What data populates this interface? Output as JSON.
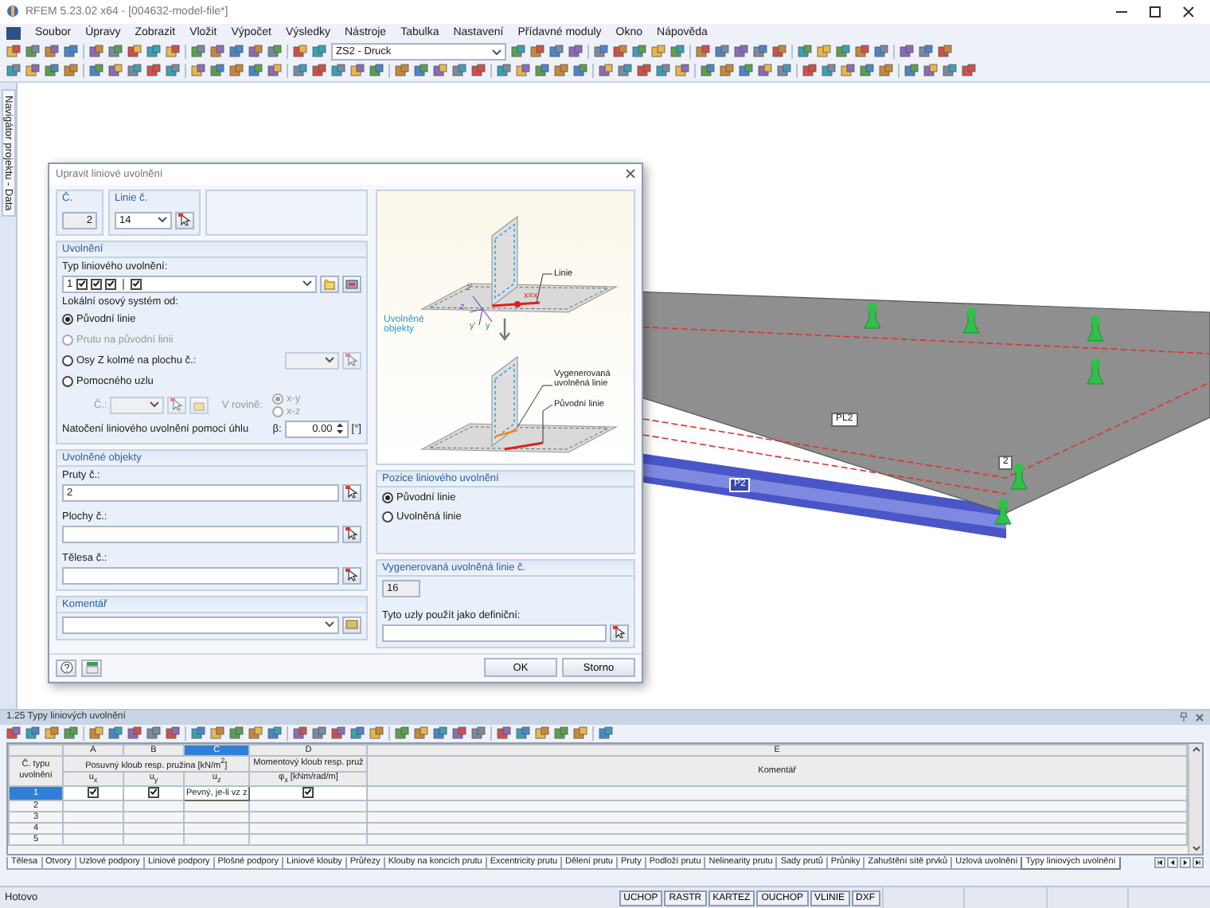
{
  "window": {
    "title": "RFEM 5.23.02 x64 - [004632-model-file*]"
  },
  "menu": [
    "Soubor",
    "Úpravy",
    "Zobrazit",
    "Vložit",
    "Výpočet",
    "Výsledky",
    "Nástroje",
    "Tabulka",
    "Nastavení",
    "Přídavné moduly",
    "Okno",
    "Nápověda"
  ],
  "toolbar": {
    "load_case": "ZS2 - Druck"
  },
  "navigator": {
    "label": "Navigátor projektu - Data"
  },
  "model_view": {
    "labels": [
      {
        "kind": "surface",
        "text": "PL2"
      },
      {
        "kind": "member",
        "text": "P2"
      },
      {
        "kind": "node",
        "text": "2"
      }
    ]
  },
  "dialog": {
    "title": "Upravit liniové uvolnění",
    "number": {
      "label": "Č.",
      "value": "2"
    },
    "line": {
      "label": "Linie č.",
      "value": "14"
    },
    "release": {
      "heading": "Uvolnění",
      "type_label": "Typ liniového uvolnění:",
      "type_number": "1",
      "type_checks": [
        {
          "checked": true
        },
        {
          "checked": true
        },
        {
          "checked": true
        },
        {
          "checked": true
        }
      ],
      "axis_label": "Lokální osový systém od:",
      "axis_options": [
        {
          "label": "Původní linie",
          "selected": true,
          "disabled": false
        },
        {
          "label": "Prutu na původní linii",
          "selected": false,
          "disabled": true
        },
        {
          "label": "Osy Z kolmé na plochu č.:",
          "selected": false,
          "disabled": false
        },
        {
          "label": "Pomocného uzlu",
          "selected": false,
          "disabled": false
        }
      ],
      "node_label": "Č.:",
      "plane_label": "V rovině:",
      "plane_options": [
        {
          "label": "x-y",
          "selected": true,
          "disabled": true
        },
        {
          "label": "x-z",
          "selected": false,
          "disabled": true
        }
      ],
      "rotation_label": "Natočení liniového uvolnění pomocí úhlu",
      "beta_label": "β:",
      "beta_value": "0.00",
      "beta_unit": "[°]"
    },
    "objects": {
      "heading": "Uvolněné objekty",
      "fields": [
        {
          "label": "Pruty č.:",
          "value": "2"
        },
        {
          "label": "Plochy č.:"
        },
        {
          "label": "Tělesa č.:"
        }
      ]
    },
    "comment": {
      "heading": "Komentář"
    },
    "diagram": {
      "labels": [
        {
          "kind": "line",
          "text": "Linie"
        },
        {
          "kind": "objects",
          "text": "Uvolněné objekty"
        },
        {
          "kind": "generated",
          "text": "Vygenerovaná uvolněná linie"
        },
        {
          "kind": "original",
          "text": "Původní linie"
        },
        {
          "kind": "axis_x",
          "text": "x=x'"
        },
        {
          "kind": "axis_z1",
          "text": "z'"
        },
        {
          "kind": "axis_z",
          "text": "z"
        },
        {
          "kind": "axis_y1",
          "text": "y'"
        },
        {
          "kind": "axis_y",
          "text": "y"
        }
      ]
    },
    "position": {
      "heading": "Pozice liniového uvolnění",
      "options": [
        {
          "label": "Původní linie",
          "selected": true
        },
        {
          "label": "Uvolněná linie",
          "selected": false
        }
      ]
    },
    "generated": {
      "heading": "Vygenerovaná uvolněná linie č.",
      "value": "16",
      "nodes_label": "Tyto uzly použít jako definiční:"
    },
    "buttons": [
      "OK",
      "Storno"
    ]
  },
  "table_panel": {
    "title": "1.25 Typy liniových uvolnění",
    "row_header": "Č. typu uvolnění",
    "columns": [
      {
        "letter": "A",
        "selected": false
      },
      {
        "letter": "B",
        "selected": false
      },
      {
        "letter": "C",
        "selected": true
      },
      {
        "letter": "D",
        "selected": false
      },
      {
        "letter": "E",
        "selected": false
      }
    ],
    "header_groups": [
      {
        "text": "Posuvný kloub resp. pružina [kN/m$^{2}$]",
        "subheaders": [
          "u$_{x}$",
          "u$_{y}$",
          "u$_{z}$"
        ]
      },
      {
        "text": "Momentový kloub resp. pruž",
        "subheaders": [
          "φ$_{x}$ [kNm/rad/m]"
        ]
      },
      {
        "text": "Komentář"
      }
    ],
    "rows": [
      {
        "number": "1",
        "selected": true,
        "cells": [
          {
            "kind": "checkbox",
            "checked": true
          },
          {
            "kind": "checkbox",
            "checked": true
          },
          {
            "kind": "text",
            "text": "Pevný, je-li vz z"
          },
          {
            "kind": "checkbox",
            "checked": true
          }
        ]
      },
      {
        "number": "2",
        "selected": false
      },
      {
        "number": "3",
        "selected": false
      },
      {
        "number": "4",
        "selected": false
      },
      {
        "number": "5",
        "selected": false
      }
    ],
    "tabs": [
      {
        "label": "Tělesa",
        "selected": false
      },
      {
        "label": "Otvory",
        "selected": false
      },
      {
        "label": "Uzlové podpory",
        "selected": false
      },
      {
        "label": "Liniové podpory",
        "selected": false
      },
      {
        "label": "Plošné podpory",
        "selected": false
      },
      {
        "label": "Liniové klouby",
        "selected": false
      },
      {
        "label": "Průřezy",
        "selected": false
      },
      {
        "label": "Klouby na koncích prutu",
        "selected": false
      },
      {
        "label": "Excentricity prutu",
        "selected": false
      },
      {
        "label": "Dělení prutu",
        "selected": false
      },
      {
        "label": "Pruty",
        "selected": false
      },
      {
        "label": "Podloží prutu",
        "selected": false
      },
      {
        "label": "Nelinearity prutu",
        "selected": false
      },
      {
        "label": "Sady prutů",
        "selected": false
      },
      {
        "label": "Průniky",
        "selected": false
      },
      {
        "label": "Zahuštění sítě prvků",
        "selected": false
      },
      {
        "label": "Uzlová uvolnění",
        "selected": false
      },
      {
        "label": "Typy liniových uvolnění",
        "selected": true
      }
    ]
  },
  "status_bar": {
    "text": "Hotovo",
    "toggles": [
      "UCHOP",
      "RASTR",
      "KARTEZ",
      "OUCHOP",
      "VLINIE",
      "DXF"
    ]
  }
}
